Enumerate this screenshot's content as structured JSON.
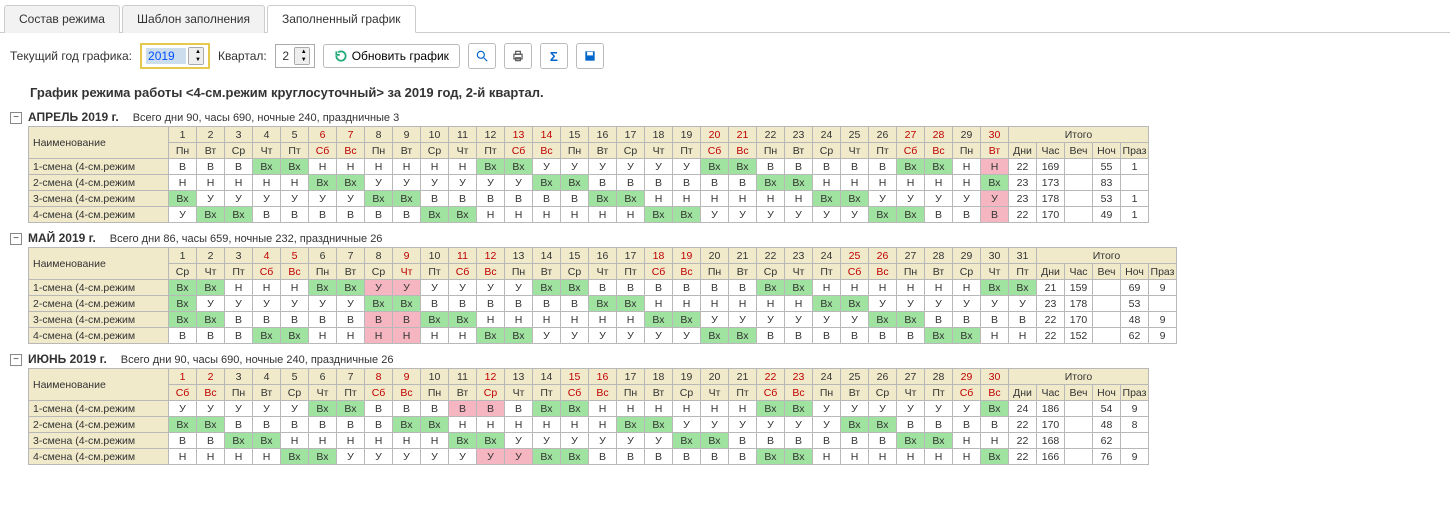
{
  "tabs": [
    "Состав режима",
    "Шаблон заполнения",
    "Заполненный график"
  ],
  "activeTab": 2,
  "toolbar": {
    "yearLabel": "Текущий год графика:",
    "year": "2019",
    "quarterLabel": "Квартал:",
    "quarter": "2",
    "refresh": "Обновить график"
  },
  "title": "График режима работы <4-см.режим круглосуточный> за 2019 год, 2-й квартал.",
  "totalsHeaders": [
    "Дни",
    "Час",
    "Веч",
    "Ноч",
    "Праз"
  ],
  "nameHeader": "Наименование",
  "itogo": "Итого",
  "months": [
    {
      "title": "АПРЕЛЬ 2019 г.",
      "summary": "Всего дни 90, часы 690, ночные 240, праздничные 3",
      "ndays": 30,
      "redDays": [
        6,
        7,
        13,
        14,
        20,
        21,
        27,
        28,
        30
      ],
      "dow": [
        "Пн",
        "Вт",
        "Ср",
        "Чт",
        "Пт",
        "Сб",
        "Вс",
        "Пн",
        "Вт",
        "Ср",
        "Чт",
        "Пт",
        "Сб",
        "Вс",
        "Пн",
        "Вт",
        "Ср",
        "Чт",
        "Пт",
        "Сб",
        "Вс",
        "Пн",
        "Вт",
        "Ср",
        "Чт",
        "Пт",
        "Сб",
        "Вс",
        "Пн",
        "Вт"
      ],
      "rows": [
        {
          "name": "1-смена (4-см.режим",
          "cells": [
            "В",
            "В",
            "В",
            "Вх",
            "Вх",
            "Н",
            "Н",
            "Н",
            "Н",
            "Н",
            "Н",
            "Вх",
            "Вх",
            "У",
            "У",
            "У",
            "У",
            "У",
            "У",
            "Вх",
            "Вх",
            "В",
            "В",
            "В",
            "В",
            "В",
            "Вх",
            "Вх",
            "Н",
            "Н"
          ],
          "vx": [
            4,
            5,
            12,
            13,
            20,
            21,
            27,
            28
          ],
          "hol": [
            30
          ],
          "totals": [
            "22",
            "169",
            "",
            "55",
            "1"
          ]
        },
        {
          "name": "2-смена (4-см.режим",
          "cells": [
            "Н",
            "Н",
            "Н",
            "Н",
            "Н",
            "Вх",
            "Вх",
            "У",
            "У",
            "У",
            "У",
            "У",
            "У",
            "Вх",
            "Вх",
            "В",
            "В",
            "В",
            "В",
            "В",
            "В",
            "Вх",
            "Вх",
            "Н",
            "Н",
            "Н",
            "Н",
            "Н",
            "Н",
            "Вх"
          ],
          "vx": [
            6,
            7,
            14,
            15,
            22,
            23,
            30
          ],
          "hol": [],
          "totals": [
            "23",
            "173",
            "",
            "83",
            ""
          ]
        },
        {
          "name": "3-смена (4-см.режим",
          "cells": [
            "Вх",
            "У",
            "У",
            "У",
            "У",
            "У",
            "У",
            "Вх",
            "Вх",
            "В",
            "В",
            "В",
            "В",
            "В",
            "В",
            "Вх",
            "Вх",
            "Н",
            "Н",
            "Н",
            "Н",
            "Н",
            "Н",
            "Вх",
            "Вх",
            "У",
            "У",
            "У",
            "У",
            "У"
          ],
          "vx": [
            1,
            8,
            9,
            16,
            17,
            24,
            25
          ],
          "hol": [
            30
          ],
          "totals": [
            "23",
            "178",
            "",
            "53",
            "1"
          ]
        },
        {
          "name": "4-смена (4-см.режим",
          "cells": [
            "У",
            "Вх",
            "Вх",
            "В",
            "В",
            "В",
            "В",
            "В",
            "В",
            "Вх",
            "Вх",
            "Н",
            "Н",
            "Н",
            "Н",
            "Н",
            "Н",
            "Вх",
            "Вх",
            "У",
            "У",
            "У",
            "У",
            "У",
            "У",
            "Вх",
            "Вх",
            "В",
            "В",
            "В"
          ],
          "vx": [
            2,
            3,
            10,
            11,
            18,
            19,
            26,
            27
          ],
          "hol": [
            30
          ],
          "totals": [
            "22",
            "170",
            "",
            "49",
            "1"
          ]
        }
      ]
    },
    {
      "title": "МАЙ 2019 г.",
      "summary": "Всего дни 86, часы 659, ночные 232, праздничные 26",
      "ndays": 31,
      "redDays": [
        4,
        5,
        9,
        11,
        12,
        18,
        19,
        25,
        26
      ],
      "dow": [
        "Ср",
        "Чт",
        "Пт",
        "Сб",
        "Вс",
        "Пн",
        "Вт",
        "Ср",
        "Чт",
        "Пт",
        "Сб",
        "Вс",
        "Пн",
        "Вт",
        "Ср",
        "Чт",
        "Пт",
        "Сб",
        "Вс",
        "Пн",
        "Вт",
        "Ср",
        "Чт",
        "Пт",
        "Сб",
        "Вс",
        "Пн",
        "Вт",
        "Ср",
        "Чт",
        "Пт"
      ],
      "rows": [
        {
          "name": "1-смена (4-см.режим",
          "cells": [
            "Вх",
            "Вх",
            "Н",
            "Н",
            "Н",
            "Вх",
            "Вх",
            "У",
            "У",
            "У",
            "У",
            "У",
            "У",
            "Вх",
            "Вх",
            "В",
            "В",
            "В",
            "В",
            "В",
            "В",
            "Вх",
            "Вх",
            "Н",
            "Н",
            "Н",
            "Н",
            "Н",
            "Н",
            "Вх",
            "Вх"
          ],
          "vx": [
            1,
            2,
            6,
            7,
            14,
            15,
            22,
            23,
            30,
            31
          ],
          "hol": [
            8,
            9
          ],
          "totals": [
            "21",
            "159",
            "",
            "69",
            "9"
          ]
        },
        {
          "name": "2-смена (4-см.режим",
          "cells": [
            "Вх",
            "У",
            "У",
            "У",
            "У",
            "У",
            "У",
            "Вх",
            "Вх",
            "В",
            "В",
            "В",
            "В",
            "В",
            "В",
            "Вх",
            "Вх",
            "Н",
            "Н",
            "Н",
            "Н",
            "Н",
            "Н",
            "Вх",
            "Вх",
            "У",
            "У",
            "У",
            "У",
            "У",
            "У"
          ],
          "vx": [
            1,
            8,
            9,
            16,
            17,
            24,
            25
          ],
          "hol": [],
          "totals": [
            "23",
            "178",
            "",
            "53",
            ""
          ]
        },
        {
          "name": "3-смена (4-см.режим",
          "cells": [
            "Вх",
            "Вх",
            "В",
            "В",
            "В",
            "В",
            "В",
            "В",
            "В",
            "Вх",
            "Вх",
            "Н",
            "Н",
            "Н",
            "Н",
            "Н",
            "Н",
            "Вх",
            "Вх",
            "У",
            "У",
            "У",
            "У",
            "У",
            "У",
            "Вх",
            "Вх",
            "В",
            "В",
            "В",
            "В"
          ],
          "vx": [
            1,
            2,
            10,
            11,
            18,
            19,
            26,
            27
          ],
          "hol": [
            8,
            9
          ],
          "totals": [
            "22",
            "170",
            "",
            "48",
            "9"
          ]
        },
        {
          "name": "4-смена (4-см.режим",
          "cells": [
            "В",
            "В",
            "В",
            "Вх",
            "Вх",
            "Н",
            "Н",
            "Н",
            "Н",
            "Н",
            "Н",
            "Вх",
            "Вх",
            "У",
            "У",
            "У",
            "У",
            "У",
            "У",
            "Вх",
            "Вх",
            "В",
            "В",
            "В",
            "В",
            "В",
            "В",
            "Вх",
            "Вх",
            "Н",
            "Н"
          ],
          "vx": [
            4,
            5,
            12,
            13,
            20,
            21,
            28,
            29
          ],
          "hol": [
            8,
            9
          ],
          "totals": [
            "22",
            "152",
            "",
            "62",
            "9"
          ]
        }
      ]
    },
    {
      "title": "ИЮНЬ 2019 г.",
      "summary": "Всего дни 90, часы 690, ночные 240, праздничные 26",
      "ndays": 30,
      "redDays": [
        1,
        2,
        8,
        9,
        12,
        15,
        16,
        22,
        23,
        29,
        30
      ],
      "dow": [
        "Сб",
        "Вс",
        "Пн",
        "Вт",
        "Ср",
        "Чт",
        "Пт",
        "Сб",
        "Вс",
        "Пн",
        "Вт",
        "Ср",
        "Чт",
        "Пт",
        "Сб",
        "Вс",
        "Пн",
        "Вт",
        "Ср",
        "Чт",
        "Пт",
        "Сб",
        "Вс",
        "Пн",
        "Вт",
        "Ср",
        "Чт",
        "Пт",
        "Сб",
        "Вс"
      ],
      "rows": [
        {
          "name": "1-смена (4-см.режим",
          "cells": [
            "У",
            "У",
            "У",
            "У",
            "У",
            "Вх",
            "Вх",
            "В",
            "В",
            "В",
            "В",
            "В",
            "В",
            "Вх",
            "Вх",
            "Н",
            "Н",
            "Н",
            "Н",
            "Н",
            "Н",
            "Вх",
            "Вх",
            "У",
            "У",
            "У",
            "У",
            "У",
            "У",
            "Вх"
          ],
          "vx": [
            6,
            7,
            14,
            15,
            22,
            23,
            30
          ],
          "hol": [
            11,
            12
          ],
          "totals": [
            "24",
            "186",
            "",
            "54",
            "9"
          ]
        },
        {
          "name": "2-смена (4-см.режим",
          "cells": [
            "Вх",
            "Вх",
            "В",
            "В",
            "В",
            "В",
            "В",
            "В",
            "Вх",
            "Вх",
            "Н",
            "Н",
            "Н",
            "Н",
            "Н",
            "Н",
            "Вх",
            "Вх",
            "У",
            "У",
            "У",
            "У",
            "У",
            "У",
            "Вх",
            "Вх",
            "В",
            "В",
            "В",
            "В"
          ],
          "vx": [
            1,
            2,
            9,
            10,
            17,
            18,
            25,
            26
          ],
          "hol": [],
          "totals": [
            "22",
            "170",
            "",
            "48",
            "8"
          ]
        },
        {
          "name": "3-смена (4-см.режим",
          "cells": [
            "В",
            "В",
            "Вх",
            "Вх",
            "Н",
            "Н",
            "Н",
            "Н",
            "Н",
            "Н",
            "Вх",
            "Вх",
            "У",
            "У",
            "У",
            "У",
            "У",
            "У",
            "Вх",
            "Вх",
            "В",
            "В",
            "В",
            "В",
            "В",
            "В",
            "Вх",
            "Вх",
            "Н",
            "Н"
          ],
          "vx": [
            3,
            4,
            11,
            12,
            19,
            20,
            27,
            28
          ],
          "hol": [],
          "totals": [
            "22",
            "168",
            "",
            "62",
            ""
          ]
        },
        {
          "name": "4-смена (4-см.режим",
          "cells": [
            "Н",
            "Н",
            "Н",
            "Н",
            "Вх",
            "Вх",
            "У",
            "У",
            "У",
            "У",
            "У",
            "У",
            "У",
            "Вх",
            "Вх",
            "В",
            "В",
            "В",
            "В",
            "В",
            "В",
            "Вх",
            "Вх",
            "Н",
            "Н",
            "Н",
            "Н",
            "Н",
            "Н",
            "Вх"
          ],
          "vx": [
            5,
            6,
            14,
            15,
            22,
            23,
            30
          ],
          "hol": [
            12,
            13
          ],
          "totals": [
            "22",
            "166",
            "",
            "76",
            "9"
          ]
        }
      ]
    }
  ]
}
